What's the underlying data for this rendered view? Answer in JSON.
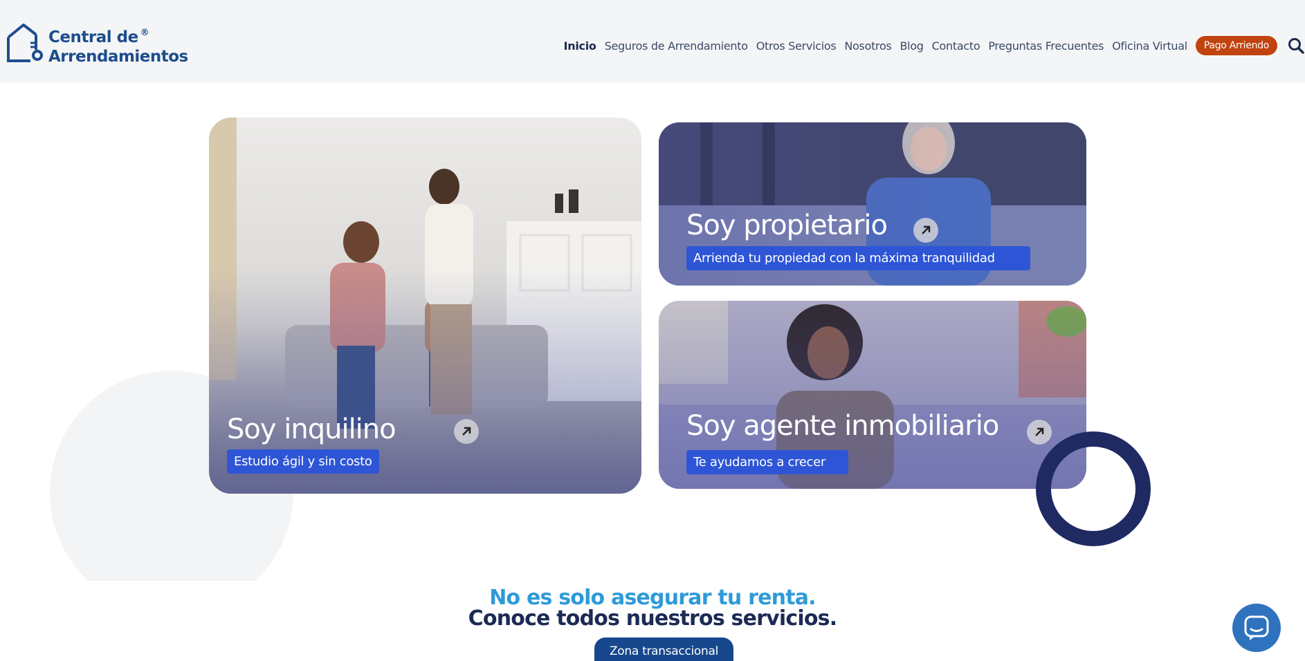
{
  "brand": {
    "name_line1": "Central de",
    "name_line2": "Arrendamientos",
    "registered_mark": "®",
    "color": "#1d4d8c"
  },
  "nav": {
    "items": [
      {
        "label": "Inicio",
        "active": true
      },
      {
        "label": "Seguros de Arrendamiento",
        "active": false
      },
      {
        "label": "Otros Servicios",
        "active": false
      },
      {
        "label": "Nosotros",
        "active": false
      },
      {
        "label": "Blog",
        "active": false
      },
      {
        "label": "Contacto",
        "active": false
      },
      {
        "label": "Preguntas Frecuentes",
        "active": false
      },
      {
        "label": "Oficina Virtual",
        "active": false
      }
    ],
    "pay_button": "Pago Arriendo",
    "pay_button_color": "#c1430f",
    "search_icon": "search-icon"
  },
  "cards": {
    "tenant": {
      "title": "Soy inquilino",
      "tag": "Estudio ágil y sin costo",
      "icon": "arrow-up-right-icon"
    },
    "owner": {
      "title": "Soy propietario",
      "tag": "Arrienda tu propiedad con la máxima tranquilidad",
      "icon": "arrow-up-right-icon"
    },
    "agent": {
      "title": "Soy agente inmobiliario",
      "tag": "Te ayudamos a crecer",
      "icon": "arrow-up-right-icon"
    }
  },
  "services": {
    "line1": "No es solo asegurar tu renta.",
    "line2": "Conoce todos nuestros servicios.",
    "button": "Zona transaccional",
    "line1_color": "#2f9ad8",
    "line2_color": "#1c2a55"
  },
  "chat": {
    "icon": "chat-icon",
    "color": "#2f73bf"
  },
  "colors": {
    "tag_blue": "#2d55d6",
    "ring": "#1f2a63"
  }
}
